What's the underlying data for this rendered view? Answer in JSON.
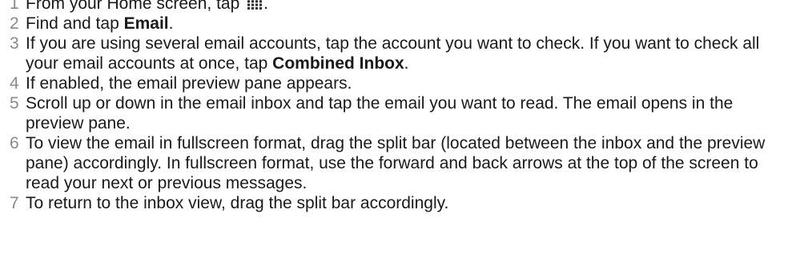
{
  "steps": [
    {
      "number": "1",
      "text_before": "From your Home screen, tap ",
      "icon": "application-screen-grid-icon",
      "text_after": "."
    },
    {
      "number": "2",
      "text_before": "Find and tap ",
      "bold": "Email",
      "text_after": "."
    },
    {
      "number": "3",
      "text_before": "If you are using several email accounts, tap the account you want to check. If you want to check all your email accounts at once, tap ",
      "bold": "Combined Inbox",
      "text_after": "."
    },
    {
      "number": "4",
      "text": "If enabled, the email preview pane appears."
    },
    {
      "number": "5",
      "text": "Scroll up or down in the email inbox and tap the email you want to read. The email opens in the preview pane."
    },
    {
      "number": "6",
      "text": "To view the email in fullscreen format, drag the split bar (located between the inbox and the preview pane) accordingly. In fullscreen format, use the forward and back arrows at the top of the screen to read your next or previous messages."
    },
    {
      "number": "7",
      "text": "To return to the inbox view, drag the split bar accordingly."
    }
  ]
}
